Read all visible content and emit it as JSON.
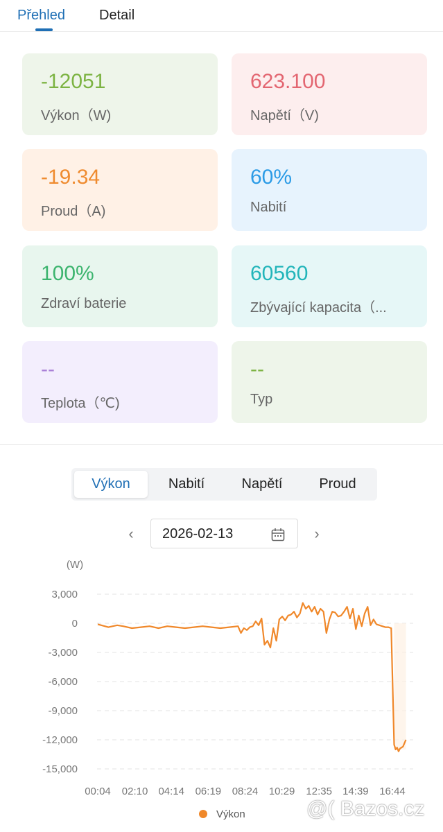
{
  "tabs": {
    "overview": "Přehled",
    "detail": "Detail"
  },
  "cards": [
    {
      "value": "-12051",
      "label": "Výkon（W)",
      "value_color": "#7cb342",
      "bg": "#eef5ea"
    },
    {
      "value": "623.100",
      "label": "Napětí（V)",
      "value_color": "#e36671",
      "bg": "#fdeeee"
    },
    {
      "value": "-19.34",
      "label": "Proud（A)",
      "value_color": "#ef8b2f",
      "bg": "#fff1e6"
    },
    {
      "value": "60%",
      "label": "Nabití",
      "value_color": "#2b9be6",
      "bg": "#e7f3fd"
    },
    {
      "value": "100%",
      "label": "Zdraví baterie",
      "value_color": "#3cb46e",
      "bg": "#e8f6ee"
    },
    {
      "value": "60560",
      "label": "Zbývající kapacita（...",
      "value_color": "#22b5ba",
      "bg": "#e6f7f7"
    },
    {
      "value": "--",
      "label": "Teplota（℃)",
      "value_color": "#a87fd6",
      "bg": "#f3eefd"
    },
    {
      "value": "--",
      "label": "Typ",
      "value_color": "#7cb342",
      "bg": "#eef5ea"
    }
  ],
  "segments": {
    "power": "Výkon",
    "charge": "Nabití",
    "voltage": "Napětí",
    "current": "Proud"
  },
  "date": "2026-02-13",
  "chart_data": {
    "type": "line",
    "unit_label": "(W)",
    "y_ticks": [
      "3,000",
      "0",
      "-3,000",
      "-6,000",
      "-9,000",
      "-12,000",
      "-15,000"
    ],
    "x_ticks": [
      "00:04",
      "02:10",
      "04:14",
      "06:19",
      "08:24",
      "10:29",
      "12:35",
      "14:39",
      "16:44"
    ],
    "ylim": [
      -15000,
      3000
    ],
    "series": [
      {
        "name": "Výkon",
        "color": "#f0882a",
        "x": [
          "00:04",
          "00:40",
          "01:10",
          "01:30",
          "02:00",
          "02:30",
          "03:00",
          "03:30",
          "04:00",
          "04:30",
          "05:00",
          "05:30",
          "06:00",
          "06:30",
          "07:00",
          "07:30",
          "08:00",
          "08:10",
          "08:20",
          "08:30",
          "08:40",
          "08:50",
          "09:00",
          "09:10",
          "09:20",
          "09:30",
          "09:40",
          "09:50",
          "10:00",
          "10:10",
          "10:20",
          "10:30",
          "10:40",
          "10:50",
          "11:00",
          "11:10",
          "11:20",
          "11:30",
          "11:40",
          "11:50",
          "12:00",
          "12:10",
          "12:20",
          "12:30",
          "12:40",
          "12:50",
          "13:00",
          "13:10",
          "13:20",
          "13:30",
          "13:40",
          "13:50",
          "14:00",
          "14:10",
          "14:20",
          "14:30",
          "14:40",
          "14:50",
          "15:00",
          "15:10",
          "15:20",
          "15:30",
          "15:40",
          "15:50",
          "16:00",
          "16:10",
          "16:20",
          "16:30",
          "16:40",
          "16:50",
          "16:55",
          "17:00",
          "17:05",
          "17:10",
          "17:20",
          "17:30"
        ],
        "values": [
          -100,
          -400,
          -200,
          -300,
          -500,
          -400,
          -300,
          -500,
          -300,
          -400,
          -500,
          -400,
          -300,
          -400,
          -500,
          -400,
          -300,
          -1000,
          -500,
          -700,
          -400,
          -300,
          200,
          -200,
          500,
          -2200,
          -1800,
          -2500,
          -500,
          -1800,
          400,
          700,
          300,
          800,
          900,
          1200,
          600,
          1000,
          2100,
          1500,
          1800,
          1200,
          1700,
          900,
          1500,
          1200,
          -1000,
          400,
          1200,
          1100,
          700,
          800,
          1200,
          1700,
          500,
          1500,
          -600,
          800,
          -300,
          1000,
          1700,
          -200,
          400,
          -100,
          -200,
          -300,
          -400,
          -400,
          -500,
          -12500,
          -13000,
          -12800,
          -13200,
          -12900,
          -12700,
          -12000
        ]
      }
    ],
    "legend": "bottom"
  },
  "watermark": "@( Bazos.cz"
}
